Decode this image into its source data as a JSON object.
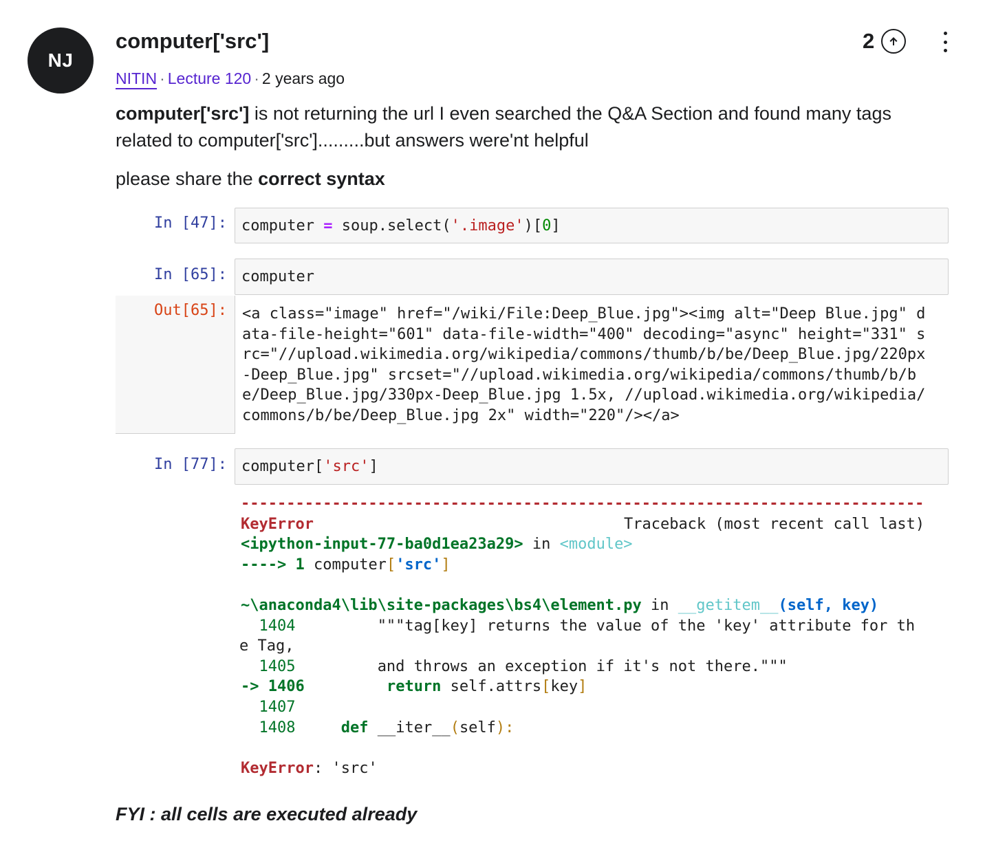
{
  "post": {
    "avatar_initials": "NJ",
    "title": "computer['src']",
    "author": "NITIN",
    "lecture": "Lecture 120",
    "time": "2 years ago",
    "separator": "·",
    "votes": "2",
    "body_bold": "computer['src']",
    "body_text": " is not returning the url I even searched the Q&A Section and found many tags related to computer['src'].........but answers were'nt helpful",
    "p2_text": "please share the ",
    "p2_bold": "correct syntax",
    "fyi": "FYI : all cells are executed already"
  },
  "icons": {
    "upvote": "arrow-up-circle-icon",
    "more": "kebab-menu-icon"
  },
  "notebook": {
    "cells": [
      {
        "prompt": "In [47]:",
        "code_a": "computer ",
        "code_op": "=",
        "code_b": " soup.select(",
        "code_str": "'.image'",
        "code_c": ")[",
        "code_num": "0",
        "code_d": "]"
      },
      {
        "prompt": "In [65]:",
        "code": "computer"
      },
      {
        "prompt": "Out[65]:",
        "output_lines": [
          "<a class=\"image\" href=\"/wiki/File:Deep_Blue.jpg\"><img alt=\"Deep Blue.jpg\" d",
          "ata-file-height=\"601\" data-file-width=\"400\" decoding=\"async\" height=\"331\" s",
          "rc=\"//upload.wikimedia.org/wikipedia/commons/thumb/b/be/Deep_Blue.jpg/220px",
          "-Deep_Blue.jpg\" srcset=\"//upload.wikimedia.org/wikipedia/commons/thumb/b/b",
          "e/Deep_Blue.jpg/330px-Deep_Blue.jpg 1.5x, //upload.wikimedia.org/wikipedia/",
          "commons/b/be/Deep_Blue.jpg 2x\" width=\"220\"/></a>"
        ]
      },
      {
        "prompt": "In [77]:",
        "code_a": "computer[",
        "code_str": "'src'",
        "code_b": "]"
      }
    ],
    "traceback": {
      "dashes": "---------------------------------------------------------------------------",
      "error_name": "KeyError",
      "traceback_label": "Traceback (most recent call last)",
      "input_ref": "<ipython-input-77-ba0d1ea23a29>",
      "in_word": " in ",
      "module": "<module>",
      "arrow_line_prefix": "----> 1 ",
      "arrow_line_code_a": "computer",
      "arrow_line_code_b": "[",
      "arrow_line_str": "'src'",
      "arrow_line_code_c": "]",
      "file_path": "~\\anaconda4\\lib\\site-packages\\bs4\\element.py",
      "func": "__getitem__",
      "func_args": "(self, key)",
      "l1404_no": "  1404",
      "l1404_text": "         \"\"\"tag[key] returns the value of the 'key' attribute for th",
      "l1404_wrap": "e Tag,",
      "l1405_no": "  1405",
      "l1405_text": "         and throws an exception if it's not there.\"\"\"",
      "l1406_arrow": "-> ",
      "l1406_no": "1406",
      "l1406_kw": "return",
      "l1406_text": " self.attrs",
      "l1406_b1": "[",
      "l1406_key": "key",
      "l1406_b2": "]",
      "l1407_no": "  1407",
      "l1408_no": "  1408",
      "l1408_kw": "def",
      "l1408_text": " __iter__",
      "l1408_p1": "(",
      "l1408_self": "self",
      "l1408_p2": "):",
      "final_error": "KeyError",
      "final_colon": ": ",
      "final_msg": "'src'"
    }
  }
}
